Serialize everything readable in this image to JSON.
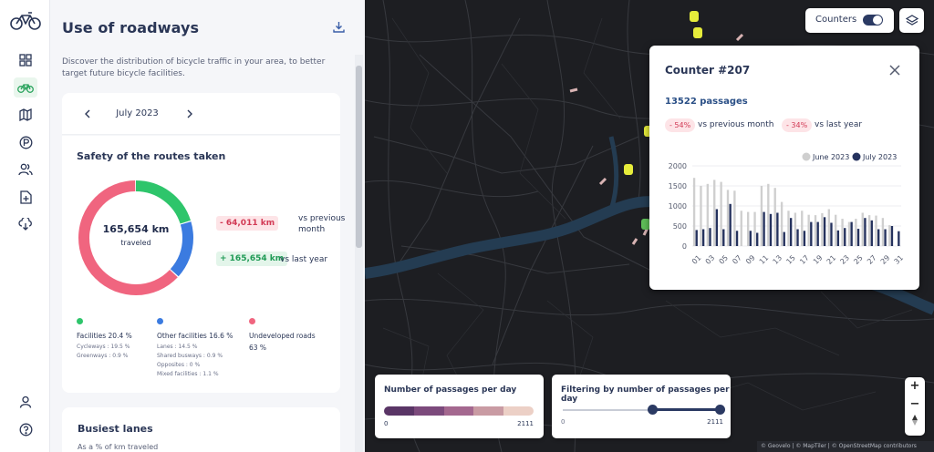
{
  "sidebar": {
    "icons": [
      "bicycle-logo-icon",
      "dashboard-icon",
      "bike-icon",
      "map-icon",
      "parking-icon",
      "users-icon",
      "add-document-icon",
      "cloud-download-icon",
      "account-icon",
      "help-icon"
    ],
    "active": "bike-icon"
  },
  "panel": {
    "title": "Use of roadways",
    "description": "Discover the distribution of bicycle traffic in your area, to better target future bicycle facilities.",
    "month": "July 2023",
    "safety": {
      "title": "Safety of the routes taken",
      "total": "165,654 km",
      "total_sub": "traveled",
      "vs_prev_value": "- 64,011 km",
      "vs_prev_label": "vs previous month",
      "vs_year_value": "+ 165,654 km",
      "vs_year_label": "vs last year",
      "segments": [
        {
          "name": "Facilities",
          "percent": 20.4,
          "color": "#2ec56b"
        },
        {
          "name": "Other facilities",
          "percent": 16.6,
          "color": "#3b7be0"
        },
        {
          "name": "Undeveloped roads",
          "percent": 63.0,
          "color": "#f0657f"
        }
      ],
      "legend": {
        "facilities": {
          "title": "Facilities 20.4 %",
          "lines": [
            "Cycleways : 19.5 %",
            "Greenways : 0.9 %"
          ]
        },
        "other": {
          "title": "Other facilities 16.6 %",
          "lines": [
            "Lanes : 14.5 %",
            "Shared busways : 0.9 %",
            "Opposites : 0 %",
            "Mixed facilities : 1.1 %"
          ]
        },
        "undeveloped": {
          "title": "Undeveloped roads",
          "value": "63 %"
        }
      }
    },
    "busiest": {
      "title": "Busiest lanes",
      "subtitle": "As a % of km traveled"
    }
  },
  "map": {
    "counters_label": "Counters",
    "counters_on": true,
    "popup": {
      "title": "Counter #207",
      "passages": "13522 passages",
      "badge1": "- 54%",
      "label1": "vs previous month",
      "badge2": "- 34%",
      "label2": "vs last year"
    },
    "legend_passages": {
      "title": "Number of passages per day",
      "min": "0",
      "max": "2111",
      "ramp": [
        "#5a3566",
        "#7c4a7c",
        "#a4688f",
        "#c99ba3",
        "#ecd0c6"
      ]
    },
    "legend_filter": {
      "title": "Filtering by number of passages per day",
      "min": "0",
      "max": "2111",
      "range_low": 0.57,
      "range_high": 1.0
    },
    "zoom_in": "+",
    "zoom_out": "−",
    "attribution": "© Geovelo | © MapTiler | © OpenStreetMap contributors"
  },
  "chart_data": {
    "type": "bar",
    "categories": [
      "01",
      "02",
      "03",
      "04",
      "05",
      "06",
      "07",
      "08",
      "09",
      "10",
      "11",
      "12",
      "13",
      "14",
      "15",
      "16",
      "17",
      "18",
      "19",
      "20",
      "21",
      "22",
      "23",
      "24",
      "25",
      "26",
      "27",
      "28",
      "29",
      "30",
      "31"
    ],
    "tick_labels": [
      "01",
      "03",
      "05",
      "07",
      "09",
      "11",
      "13",
      "15",
      "17",
      "19",
      "21",
      "23",
      "25",
      "27",
      "29",
      "31"
    ],
    "series": [
      {
        "name": "June 2023",
        "color": "#cfcfcf",
        "values": [
          1700,
          1500,
          1550,
          1650,
          1600,
          1400,
          1380,
          880,
          850,
          850,
          1500,
          1550,
          1450,
          1100,
          880,
          830,
          880,
          780,
          770,
          820,
          920,
          780,
          680,
          600,
          680,
          830,
          770,
          760,
          700,
          520,
          0
        ]
      },
      {
        "name": "July 2023",
        "color": "#25325e",
        "values": [
          400,
          420,
          450,
          920,
          420,
          1050,
          380,
          0,
          380,
          330,
          850,
          800,
          830,
          350,
          700,
          420,
          380,
          600,
          600,
          720,
          580,
          390,
          450,
          600,
          430,
          700,
          640,
          420,
          420,
          500,
          370
        ]
      }
    ],
    "title": "",
    "xlabel": "",
    "ylabel": "",
    "ylim": [
      0,
      2000
    ],
    "yticks": [
      0,
      500,
      1000,
      1500,
      2000
    ],
    "legend": "top-right",
    "grid": true
  }
}
